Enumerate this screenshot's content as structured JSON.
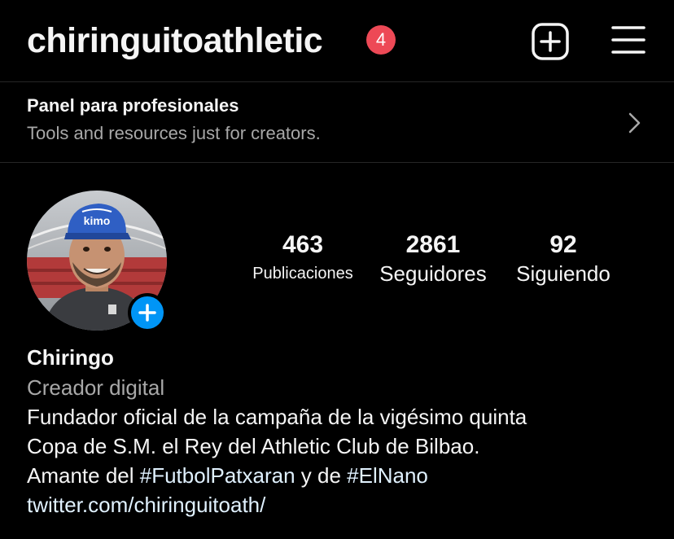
{
  "header": {
    "username": "chiringuitoathletic",
    "notification_count": "4",
    "create_icon": "plus-square-icon",
    "menu_icon": "hamburger-menu-icon"
  },
  "pro_panel": {
    "title": "Panel para profesionales",
    "subtitle": "Tools and resources just for creators.",
    "icon": "chevron-right-icon"
  },
  "profile": {
    "avatar_icon": "profile-photo",
    "add_story_icon": "plus-icon",
    "stats": [
      {
        "value": "463",
        "label": "Publicaciones"
      },
      {
        "value": "2861",
        "label": "Seguidores"
      },
      {
        "value": "92",
        "label": "Siguiendo"
      }
    ],
    "display_name": "Chiringo",
    "category": "Creador digital",
    "bio": {
      "line1": "Fundador oficial de la campaña de la vigésimo quinta",
      "line2": "Copa de S.M. el Rey del Athletic Club de Bilbao.",
      "line3_prefix": "Amante del ",
      "hashtag1": "#FutbolPatxaran",
      "line3_middle": " y de ",
      "hashtag2": "#ElNano"
    },
    "link": "twitter.com/chiringuitoath/"
  },
  "colors": {
    "background": "#000000",
    "primary_text": "#f5f5f5",
    "secondary_text": "#a8a8a8",
    "badge": "#ed4956",
    "accent_blue": "#0095f6",
    "link": "#e0f1ff",
    "divider": "#262626"
  }
}
